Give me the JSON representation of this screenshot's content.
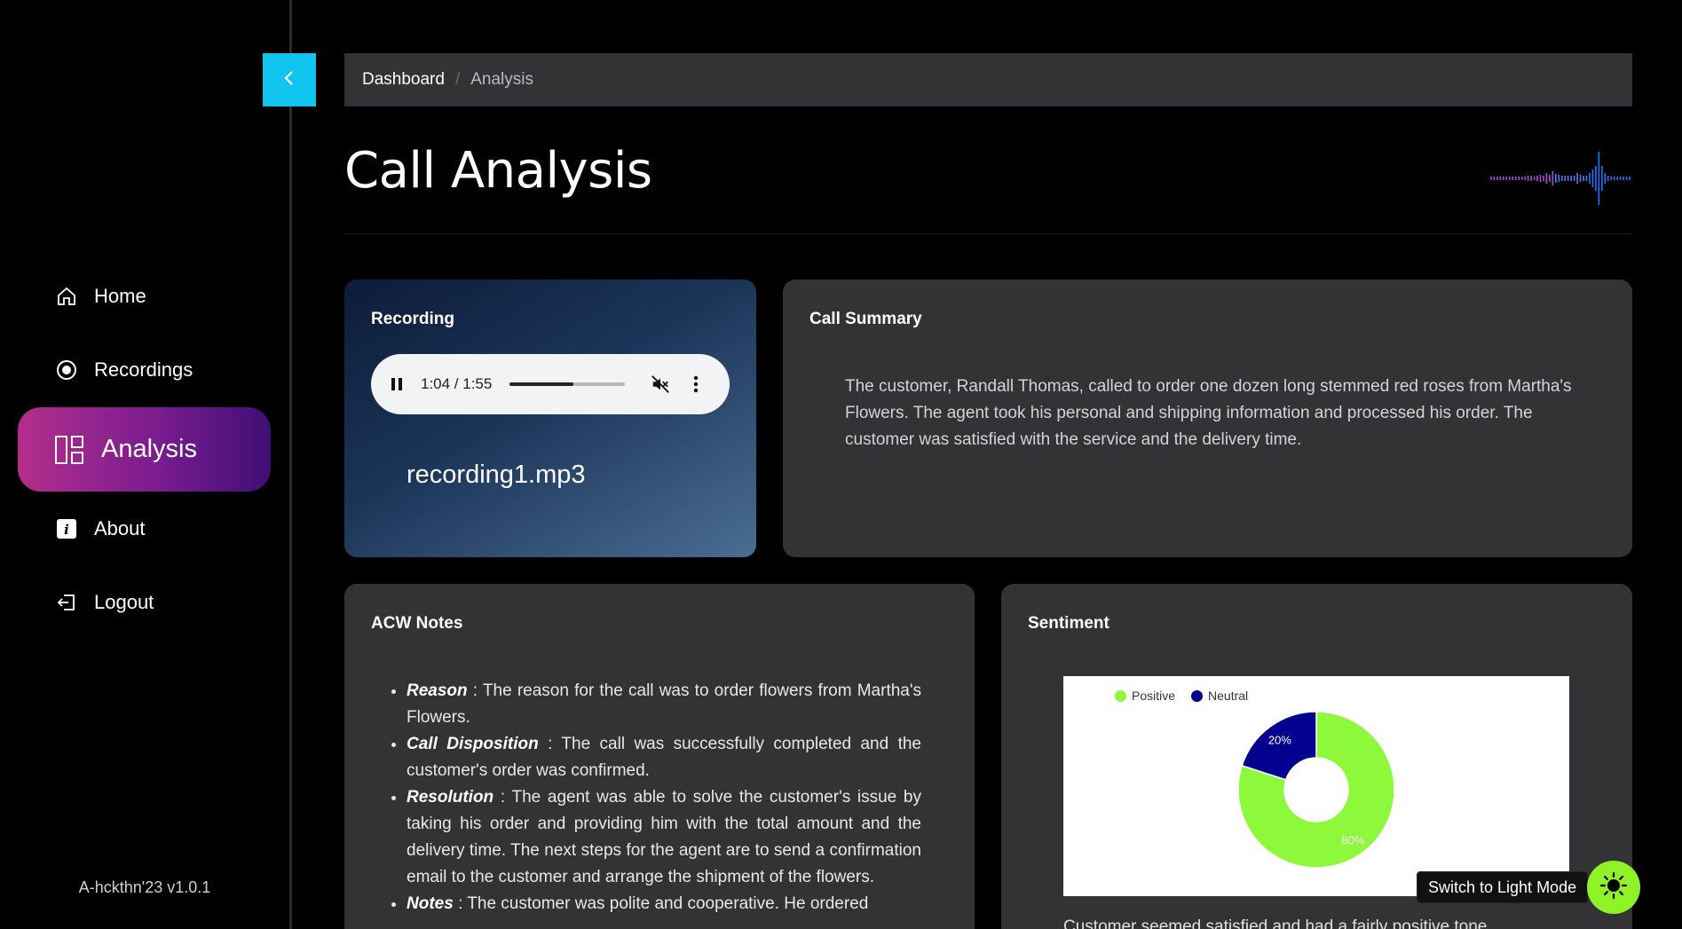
{
  "app": {
    "version": "A-hckthn'23 v1.0.1"
  },
  "sidebar": {
    "items": [
      {
        "label": "Home",
        "icon": "home-icon"
      },
      {
        "label": "Recordings",
        "icon": "record-icon"
      },
      {
        "label": "Analysis",
        "icon": "dashboard-icon",
        "active": true
      },
      {
        "label": "About",
        "icon": "info-icon"
      },
      {
        "label": "Logout",
        "icon": "logout-icon"
      }
    ],
    "active_gradient": [
      "#b32e8c",
      "#3f0f76"
    ]
  },
  "breadcrumb": {
    "home": "Dashboard",
    "separator": "/",
    "current": "Analysis"
  },
  "page": {
    "title": "Call Analysis"
  },
  "recording": {
    "title": "Recording",
    "player": {
      "time": "1:04 / 1:55",
      "progress_fraction": 0.55,
      "state": "playing",
      "muted": true
    },
    "filename": "recording1.mp3"
  },
  "summary": {
    "title": "Call Summary",
    "text": "The customer, Randall Thomas, called to order one dozen long stemmed red roses from Martha's Flowers. The agent took his personal and shipping information and processed his order. The customer was satisfied with the service and the delivery time."
  },
  "acw": {
    "title": "ACW Notes",
    "items": [
      {
        "label": "Reason",
        "text": " : The reason for the call was to order flowers from Martha's Flowers."
      },
      {
        "label": "Call Disposition",
        "text": " : The call was successfully completed and the customer's order was confirmed."
      },
      {
        "label": "Resolution",
        "text": " : The agent was able to solve the customer's issue by taking his order and providing him with the total amount and the delivery time. The next steps for the agent are to send a confirmation email to the customer and arrange the shipment of the flowers."
      },
      {
        "label": "Notes",
        "text": " : The customer was polite and cooperative. He ordered"
      }
    ]
  },
  "sentiment": {
    "title": "Sentiment",
    "caption": "Customer seemed satisfied and had a fairly positive tone."
  },
  "chart_data": {
    "type": "pie",
    "donut": true,
    "categories": [
      "Positive",
      "Neutral"
    ],
    "values": [
      80,
      20
    ],
    "data_labels": [
      "80%",
      "20%"
    ],
    "colors": [
      "#8ef83b",
      "#03008f"
    ],
    "legend": "top-left"
  },
  "theme_toggle": {
    "tooltip": "Switch to Light Mode",
    "color": "#8ef226"
  },
  "colors": {
    "accent": "#12c5ee",
    "card_bg": "#333336"
  }
}
